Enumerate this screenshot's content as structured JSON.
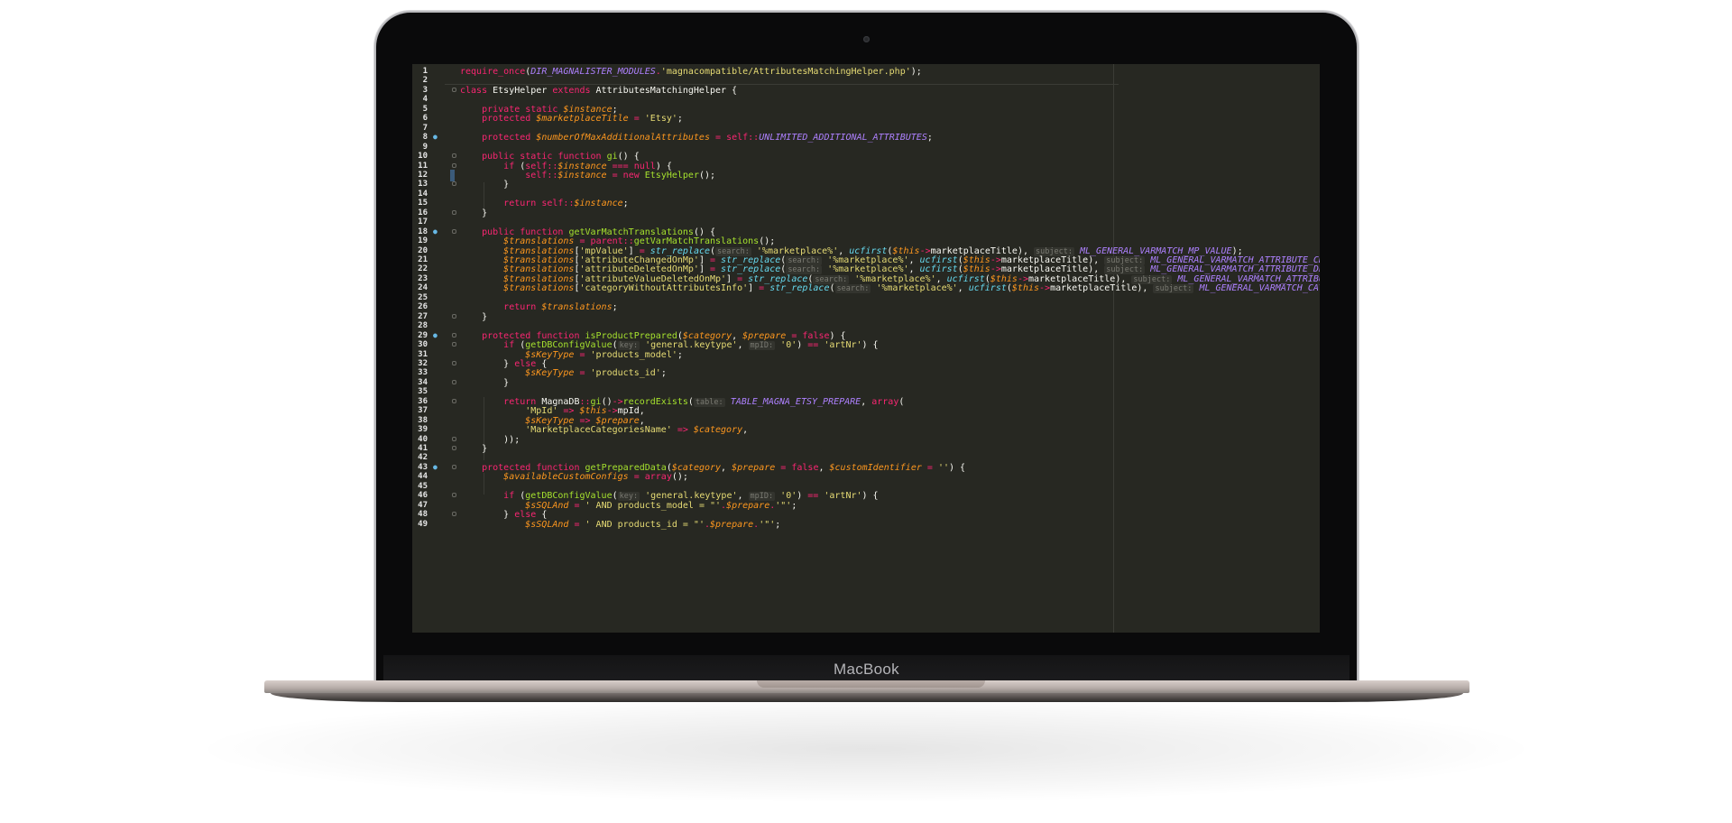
{
  "device": {
    "brand": "MacBook"
  },
  "editor": {
    "lines": [
      {
        "n": "1",
        "code": "require_once(DIR_MAGNALISTER_MODULES.'magnacompatible/AttributesMatchingHelper.php');"
      },
      {
        "n": "2",
        "code": ""
      },
      {
        "n": "3",
        "code": "class EtsyHelper extends AttributesMatchingHelper {"
      },
      {
        "n": "4",
        "code": ""
      },
      {
        "n": "5",
        "code": "    private static $instance;"
      },
      {
        "n": "6",
        "code": "    protected $marketplaceTitle = 'Etsy';"
      },
      {
        "n": "7",
        "code": ""
      },
      {
        "n": "8",
        "code": "    protected $numberOfMaxAdditionalAttributes = self::UNLIMITED_ADDITIONAL_ATTRIBUTES;"
      },
      {
        "n": "9",
        "code": ""
      },
      {
        "n": "10",
        "code": "    public static function gi() {"
      },
      {
        "n": "11",
        "code": "        if (self::$instance === null) {"
      },
      {
        "n": "12",
        "code": "            self::$instance = new EtsyHelper();"
      },
      {
        "n": "13",
        "code": "        }"
      },
      {
        "n": "14",
        "code": ""
      },
      {
        "n": "15",
        "code": "        return self::$instance;"
      },
      {
        "n": "16",
        "code": "    }"
      },
      {
        "n": "17",
        "code": ""
      },
      {
        "n": "18",
        "code": "    public function getVarMatchTranslations() {"
      },
      {
        "n": "19",
        "code": "        $translations = parent::getVarMatchTranslations();"
      },
      {
        "n": "20",
        "code": "        $translations['mpValue'] = str_replace( search: '%marketplace%', ucfirst($this->marketplaceTitle),  subject: ML_GENERAL_VARMATCH_MP_VALUE);"
      },
      {
        "n": "21",
        "code": "        $translations['attributeChangedOnMp'] = str_replace( search: '%marketplace%', ucfirst($this->marketplaceTitle),  subject: ML_GENERAL_VARMATCH_ATTRIBUTE_CH"
      },
      {
        "n": "22",
        "code": "        $translations['attributeDeletedOnMp'] = str_replace( search: '%marketplace%', ucfirst($this->marketplaceTitle),  subject: ML_GENERAL_VARMATCH_ATTRIBUTE_DE"
      },
      {
        "n": "23",
        "code": "        $translations['attributeValueDeletedOnMp'] = str_replace( search: '%marketplace%', ucfirst($this->marketplaceTitle),  subject: ML_GENERAL_VARMATCH_ATTRIBU"
      },
      {
        "n": "24",
        "code": "        $translations['categoryWithoutAttributesInfo'] = str_replace( search: '%marketplace%', ucfirst($this->marketplaceTitle),  subject: ML_GENERAL_VARMATCH_CAT"
      },
      {
        "n": "25",
        "code": ""
      },
      {
        "n": "26",
        "code": "        return $translations;"
      },
      {
        "n": "27",
        "code": "    }"
      },
      {
        "n": "28",
        "code": ""
      },
      {
        "n": "29",
        "code": "    protected function isProductPrepared($category, $prepare = false) {"
      },
      {
        "n": "30",
        "code": "        if (getDBConfigValue( key: 'general.keytype',  mpID: '0') == 'artNr') {"
      },
      {
        "n": "31",
        "code": "            $sKeyType = 'products_model';"
      },
      {
        "n": "32",
        "code": "        } else {"
      },
      {
        "n": "33",
        "code": "            $sKeyType = 'products_id';"
      },
      {
        "n": "34",
        "code": "        }"
      },
      {
        "n": "35",
        "code": ""
      },
      {
        "n": "36",
        "code": "        return MagnaDB::gi()->recordExists( table: TABLE_MAGNA_ETSY_PREPARE, array("
      },
      {
        "n": "37",
        "code": "            'MpId' => $this->mpId,"
      },
      {
        "n": "38",
        "code": "            $sKeyType => $prepare,"
      },
      {
        "n": "39",
        "code": "            'MarketplaceCategoriesName' => $category,"
      },
      {
        "n": "40",
        "code": "        ));"
      },
      {
        "n": "41",
        "code": "    }"
      },
      {
        "n": "42",
        "code": ""
      },
      {
        "n": "43",
        "code": "    protected function getPreparedData($category, $prepare = false, $customIdentifier = '') {"
      },
      {
        "n": "44",
        "code": "        $availableCustomConfigs = array();"
      },
      {
        "n": "45",
        "code": ""
      },
      {
        "n": "46",
        "code": "        if (getDBConfigValue( key: 'general.keytype',  mpID: '0') == 'artNr') {"
      },
      {
        "n": "47",
        "code": "            $sSQLAnd = ' AND products_model = \"'.$prepare.'\"';"
      },
      {
        "n": "48",
        "code": "        } else {"
      },
      {
        "n": "49",
        "code": "            $sSQLAnd = ' AND products_id = \"'.$prepare.'\"';"
      }
    ]
  }
}
